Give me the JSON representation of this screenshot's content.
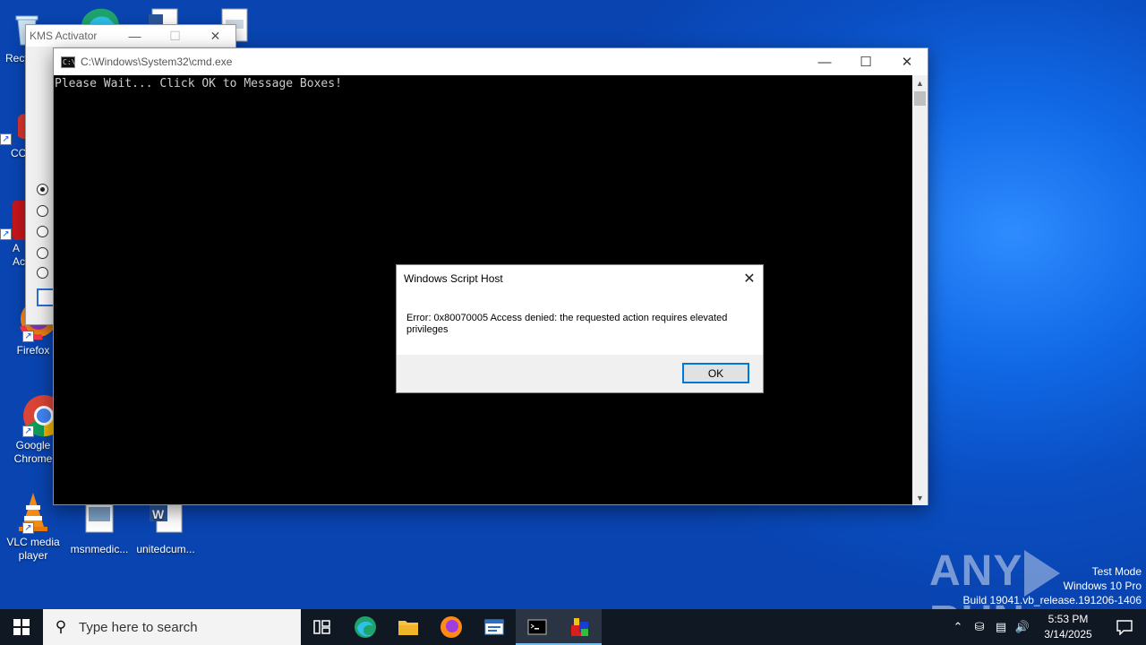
{
  "desktop": {
    "icons": [
      {
        "label": "Recy"
      },
      {
        "label": "CC"
      },
      {
        "label": "A Ac"
      },
      {
        "label": "Firefox"
      },
      {
        "label": "Google Chrome"
      },
      {
        "label": "VLC media player"
      },
      {
        "label": "msnmedic..."
      },
      {
        "label": "unitedcum..."
      }
    ]
  },
  "kms_window": {
    "title": "KMS Activator",
    "minimize": "—",
    "maximize": "☐",
    "close": "✕"
  },
  "cmd_window": {
    "title": "C:\\Windows\\System32\\cmd.exe",
    "console_text": "Please Wait... Click OK to Message Boxes!",
    "minimize": "—",
    "maximize": "☐",
    "close": "✕"
  },
  "message_box": {
    "title": "Windows Script Host",
    "message": "Error: 0x80070005 Access denied: the requested action requires elevated privileges",
    "ok_label": "OK",
    "close": "✕"
  },
  "watermark": {
    "left": "ANY",
    "right": "RUN"
  },
  "system_info": {
    "line1": "Test Mode",
    "line2": "Windows 10 Pro",
    "line3": "Build 19041.vb_release.191206-1406"
  },
  "taskbar": {
    "search_placeholder": "Type here to search",
    "time": "5:53 PM",
    "date": "3/14/2025",
    "accent": "#76b9ed"
  }
}
